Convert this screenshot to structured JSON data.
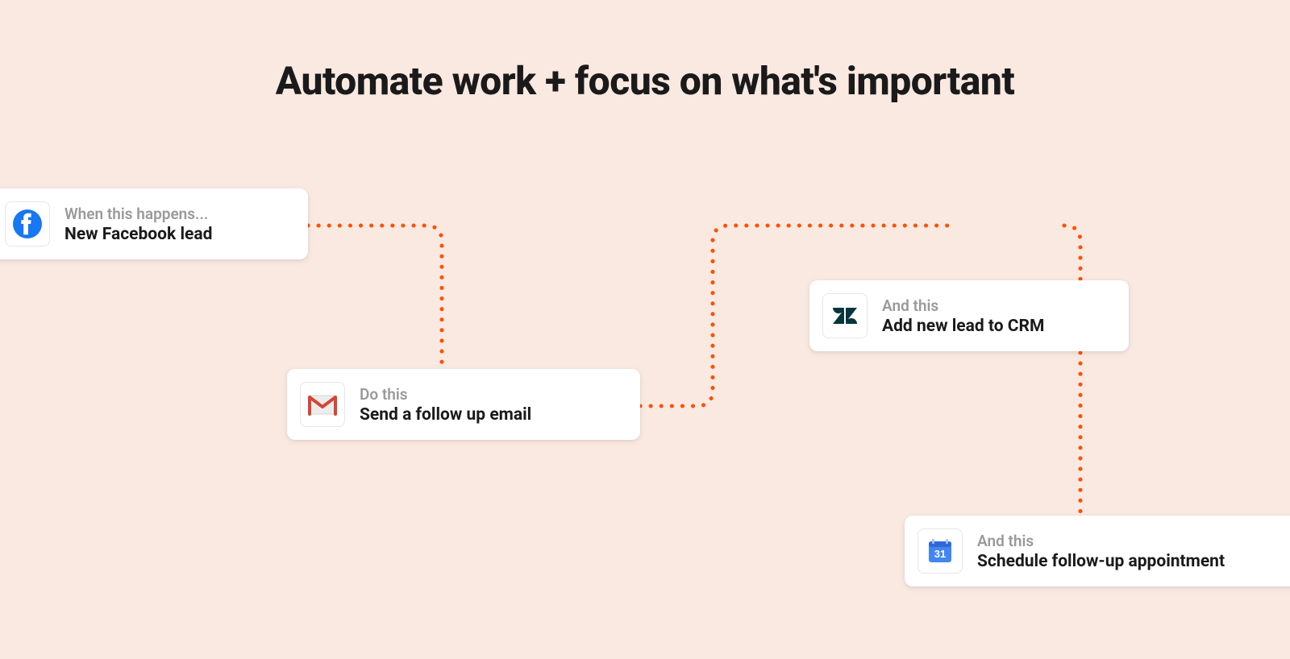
{
  "title": "Automate work + focus on what's important",
  "cards": {
    "c1": {
      "subtitle": "When this happens...",
      "action": "New Facebook lead",
      "icon": "facebook"
    },
    "c2": {
      "subtitle": "Do this",
      "action": "Send a follow up email",
      "icon": "gmail"
    },
    "c3": {
      "subtitle": "And this",
      "action": "Add new lead to CRM",
      "icon": "zendesk"
    },
    "c4": {
      "subtitle": "And this",
      "action": "Schedule follow-up appointment",
      "icon": "google-calendar",
      "calendar_day": "31"
    }
  },
  "connector_color": "#ff4f00"
}
